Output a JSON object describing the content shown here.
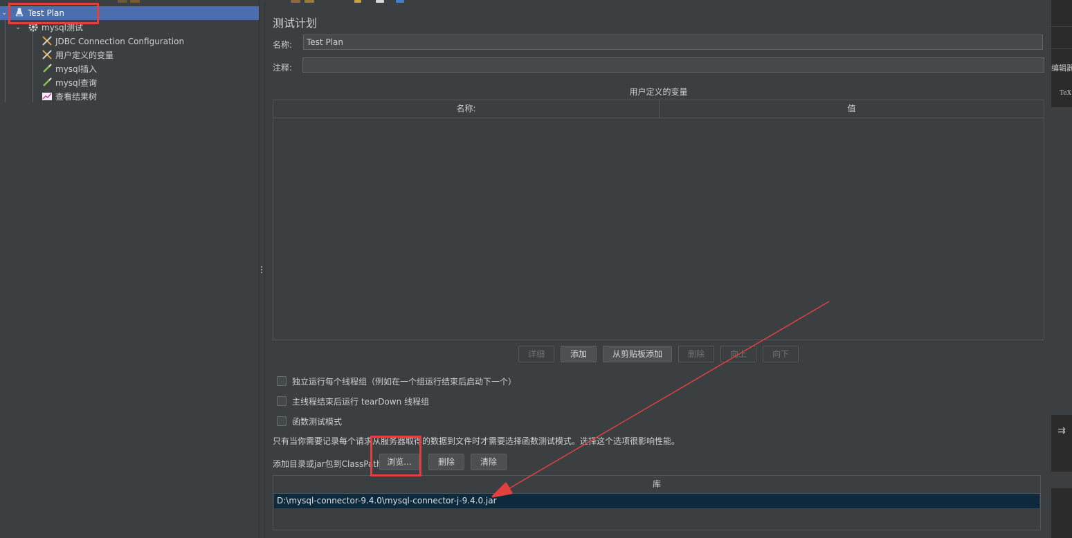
{
  "tree": {
    "items": [
      {
        "label": "Test Plan",
        "icon": "test-plan-icon"
      },
      {
        "label": "mysql测试",
        "icon": "gear-icon"
      },
      {
        "label": "JDBC Connection Configuration",
        "icon": "config-wrench-icon"
      },
      {
        "label": "用户定义的变量",
        "icon": "config-wrench-icon"
      },
      {
        "label": "mysql插入",
        "icon": "pipette-sampler-icon"
      },
      {
        "label": "mysql查询",
        "icon": "pipette-sampler-icon"
      },
      {
        "label": "查看结果树",
        "icon": "listener-chart-icon"
      }
    ]
  },
  "main": {
    "title": "测试计划",
    "name_label": "名称:",
    "name_value": "Test Plan",
    "comment_label": "注释:",
    "comment_value": "",
    "vars_title": "用户定义的变量",
    "vars_columns": [
      "名称:",
      "值"
    ],
    "buttons": {
      "detail": "详细",
      "add": "添加",
      "add_clipboard": "从剪贴板添加",
      "delete": "删除",
      "up": "向上",
      "down": "向下"
    },
    "options": [
      {
        "label": "独立运行每个线程组（例如在一个组运行结束后启动下一个）",
        "checked": false
      },
      {
        "label": "主线程结束后运行 tearDown 线程组",
        "checked": false
      },
      {
        "label": "函数测试模式",
        "checked": false
      }
    ],
    "functional_note": "只有当你需要记录每个请求从服务器取得的数据到文件时才需要选择函数测试模式。选择这个选项很影响性能。",
    "classpath_label": "添加目录或jar包到ClassPath",
    "classpath_buttons": {
      "browse": "浏览...",
      "delete": "删除",
      "clear": "清除"
    },
    "library_header": "库",
    "library_rows": [
      "D:\\mysql-connector-9.4.0\\mysql-connector-j-9.4.0.jar"
    ]
  },
  "right_strip": {
    "text1": "编辑器",
    "text2": "TeX"
  },
  "colors": {
    "background": "#3c3f41",
    "selection": "#4b6eaf",
    "library_selection": "#0d293e",
    "annotation_red": "#e2403f"
  }
}
